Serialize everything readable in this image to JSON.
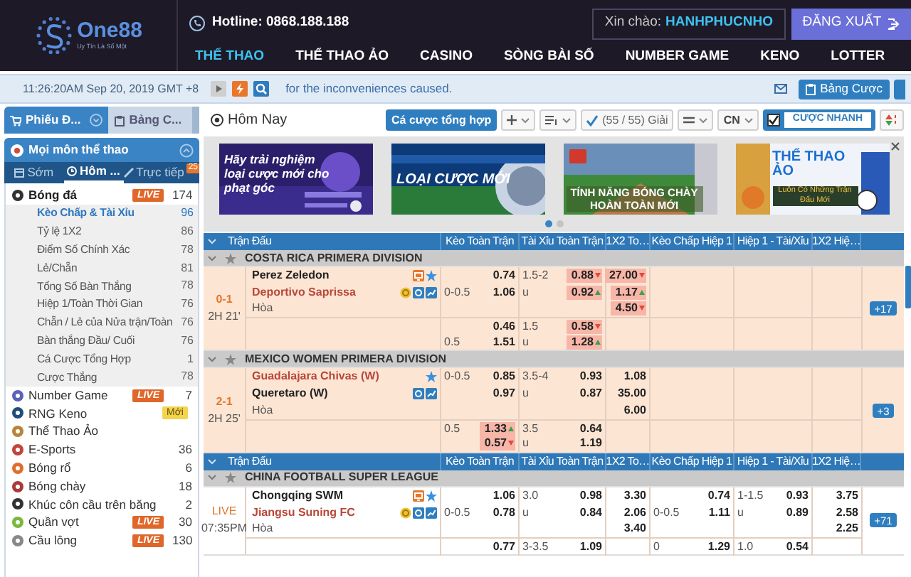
{
  "header": {
    "logo": "One88",
    "tagline": "Uy Tín Là Số Một",
    "hotline": "Hotline: 0868.188.188",
    "greeting": "Xin chào:",
    "username": "HANHPHUCNHO",
    "logout": "ĐĂNG XUẤT",
    "nav": [
      {
        "label": "THỂ THAO",
        "selected": true
      },
      {
        "label": "THỂ THAO ẢO",
        "selected": false
      },
      {
        "label": "CASINO",
        "selected": false
      },
      {
        "label": "SÒNG BÀI SỐ",
        "selected": false
      },
      {
        "label": "NUMBER GAME",
        "selected": false
      },
      {
        "label": "KENO",
        "selected": false
      },
      {
        "label": "LOTTER",
        "selected": false
      }
    ]
  },
  "info_bar": {
    "time": "11:26:20AM Sep 20, 2019 GMT +8",
    "message": "for the inconveniences caused.",
    "button": "Bảng Cược"
  },
  "sidebar": {
    "tabs": [
      {
        "label": "Phiếu Đ...",
        "selected": true
      },
      {
        "label": "Bảng C...",
        "selected": false
      }
    ],
    "panel_title": "Mọi môn thể thao",
    "subtabs": [
      {
        "label": "Sớm",
        "selected": false
      },
      {
        "label": "Hôm ...",
        "selected": true
      },
      {
        "label": "Trực tiếp",
        "selected": false,
        "badge": "25"
      }
    ],
    "sports": [
      {
        "name": "Bóng đá",
        "badge": {
          "text": "LIVE",
          "kind": "live"
        },
        "count": "174",
        "expanded": true,
        "children": [
          {
            "name": "Kèo Chấp & Tài Xỉu",
            "count": "96",
            "selected": true
          },
          {
            "name": "Tỷ lệ 1X2",
            "count": "86",
            "selected": false
          },
          {
            "name": "Điểm Số Chính Xác",
            "count": "78",
            "selected": false
          },
          {
            "name": "Lẻ/Chẵn",
            "count": "81",
            "selected": false
          },
          {
            "name": "Tổng Số Bàn Thắng",
            "count": "78",
            "selected": false
          },
          {
            "name": "Hiệp 1/Toàn Thời Gian",
            "count": "76",
            "selected": false
          },
          {
            "name": "Chẵn / Lẻ của Nửa trận/Toàn",
            "count": "76",
            "selected": false
          },
          {
            "name": "Bàn thắng Đầu/ Cuối",
            "count": "76",
            "selected": false
          },
          {
            "name": "Cá Cược Tổng Hợp",
            "count": "1",
            "selected": false
          },
          {
            "name": "Cược Thắng",
            "count": "78",
            "selected": false
          }
        ]
      },
      {
        "name": "Number Game",
        "badge": {
          "text": "LIVE",
          "kind": "live"
        },
        "count": "7",
        "expanded": false
      },
      {
        "name": "RNG Keno",
        "badge": {
          "text": "Mới",
          "kind": "new"
        },
        "expanded": false
      },
      {
        "name": "Thể Thao Ảo",
        "expanded": false
      },
      {
        "name": "E-Sports",
        "count": "36",
        "expanded": false
      },
      {
        "name": "Bóng rổ",
        "count": "6",
        "expanded": false
      },
      {
        "name": "Bóng chày",
        "count": "18",
        "expanded": false
      },
      {
        "name": "Khúc côn cầu trên băng",
        "count": "2",
        "expanded": false
      },
      {
        "name": "Quần vợt",
        "badge": {
          "text": "LIVE",
          "kind": "live"
        },
        "count": "30",
        "expanded": false
      },
      {
        "name": "Cầu lông",
        "badge": {
          "text": "LIVE",
          "kind": "live"
        },
        "count": "130",
        "expanded": false
      }
    ]
  },
  "toolbar": {
    "title": "Hôm Nay",
    "combo_button": "Cá cược tổng hợp",
    "league_filter": "(55 / 55) Giải",
    "language": "CN",
    "quick_bet": {
      "label": "CƯỢC NHANH",
      "checked": true
    }
  },
  "banners": {
    "slides": [
      {
        "kind": "corner",
        "title": "Hãy trải nghiệm loại cược mới cho phạt góc"
      },
      {
        "kind": "stadium",
        "title": "LOẠI CƯỢC MỚI"
      },
      {
        "kind": "baseball",
        "title": "TÍNH NĂNG BÓNG CHÀY HOÀN TOÀN MỚI"
      },
      {
        "kind": "virtual",
        "title": "THỂ THAO ẢO",
        "subtitle": "Luôn Có Những Trận Đấu Mới"
      }
    ],
    "dots": [
      {
        "selected": true
      },
      {
        "selected": false
      }
    ]
  },
  "table": {
    "rows": [
      {
        "kind": "header",
        "columns": [
          "Trận Đấu",
          "Kèo Toàn Trận",
          "Tài Xỉu Toàn Trận",
          "1X2 To…",
          "Kèo Chấp Hiệp 1",
          "Hiệp 1 - Tài/Xỉu",
          "1X2 Hiệ…"
        ]
      },
      {
        "kind": "league",
        "name": "COSTA RICA PRIMERA DIVISION"
      },
      {
        "kind": "match",
        "in_play": true,
        "status": "0-1",
        "time": "2H 21'",
        "more": "+17",
        "lines": [
          {
            "kind": "team",
            "team": "Perez Zeledon",
            "favorite": false,
            "icons": [
              {
                "kind": "tv"
              },
              {
                "kind": "star"
              }
            ],
            "cells": [
              "",
              "0.74",
              "1.5-2",
              {
                "v": "0.88",
                "kind": "down"
              },
              {
                "v": "27.00",
                "kind": "down"
              },
              "",
              "",
              "",
              "",
              ""
            ]
          },
          {
            "kind": "team",
            "team": "Deportivo Saprissa",
            "favorite": true,
            "icons": [
              {
                "kind": "coin"
              },
              {
                "kind": "money"
              },
              {
                "kind": "stats"
              }
            ],
            "cells": [
              "0-0.5",
              "1.06",
              "u",
              {
                "v": "0.92",
                "kind": "up"
              },
              {
                "v": "1.17",
                "kind": "up"
              },
              "",
              "",
              "",
              "",
              ""
            ]
          },
          {
            "kind": "draw",
            "team": "Hòa",
            "cells": [
              "",
              "",
              "",
              "",
              {
                "v": "4.50",
                "kind": "down"
              },
              "",
              "",
              "",
              "",
              ""
            ]
          },
          {
            "kind": "extra",
            "cells": [
              "",
              "0.46",
              "1.5",
              {
                "v": "0.58",
                "kind": "down"
              },
              "",
              "",
              "",
              "",
              "",
              ""
            ]
          },
          {
            "kind": "extra",
            "cells": [
              "0.5",
              "1.51",
              "u",
              {
                "v": "1.28",
                "kind": "up"
              },
              "",
              "",
              "",
              "",
              "",
              ""
            ]
          }
        ]
      },
      {
        "kind": "league",
        "name": "MEXICO WOMEN PRIMERA DIVISION"
      },
      {
        "kind": "match",
        "in_play": true,
        "status": "2-1",
        "time": "2H 25'",
        "more": "+3",
        "lines": [
          {
            "kind": "team",
            "team": "Guadalajara Chivas (W)",
            "favorite": true,
            "icons": [
              {
                "kind": "star"
              }
            ],
            "cells": [
              "0-0.5",
              "0.85",
              "3.5-4",
              "0.93",
              "1.08",
              "",
              "",
              "",
              "",
              ""
            ]
          },
          {
            "kind": "team",
            "team": "Queretaro (W)",
            "favorite": false,
            "icons": [
              {
                "kind": "money"
              },
              {
                "kind": "stats"
              }
            ],
            "cells": [
              "",
              "0.97",
              "u",
              "0.87",
              "35.00",
              "",
              "",
              "",
              "",
              ""
            ]
          },
          {
            "kind": "draw",
            "team": "Hòa",
            "cells": [
              "",
              "",
              "",
              "",
              "6.00",
              "",
              "",
              "",
              "",
              ""
            ]
          },
          {
            "kind": "extra",
            "cells": [
              "0.5",
              {
                "v": "1.33",
                "kind": "up"
              },
              "3.5",
              "0.64",
              "",
              "",
              "",
              "",
              "",
              ""
            ]
          },
          {
            "kind": "extra",
            "cells": [
              "",
              {
                "v": "0.57",
                "kind": "down"
              },
              "u",
              "1.19",
              "",
              "",
              "",
              "",
              "",
              ""
            ]
          }
        ]
      },
      {
        "kind": "header",
        "columns": [
          "Trận Đấu",
          "Kèo Toàn Trận",
          "Tài Xỉu Toàn Trận",
          "1X2 To…",
          "Kèo Chấp Hiệp 1",
          "Hiệp 1 - Tài/Xỉu",
          "1X2 Hiệ…"
        ]
      },
      {
        "kind": "league",
        "name": "CHINA FOOTBALL SUPER LEAGUE"
      },
      {
        "kind": "match",
        "in_play": false,
        "status": "LIVE",
        "time": "07:35PM",
        "more": "+71",
        "lines": [
          {
            "kind": "team",
            "team": "Chongqing SWM",
            "favorite": false,
            "icons": [
              {
                "kind": "tv"
              },
              {
                "kind": "star"
              }
            ],
            "cells": [
              "",
              "1.06",
              "3.0",
              "0.98",
              "3.30",
              "",
              "0.74",
              "1-1.5",
              "0.93",
              "3.75"
            ]
          },
          {
            "kind": "team",
            "team": "Jiangsu Suning FC",
            "favorite": true,
            "icons": [
              {
                "kind": "coin"
              },
              {
                "kind": "money"
              },
              {
                "kind": "stats"
              }
            ],
            "cells": [
              "0-0.5",
              "0.78",
              "u",
              "0.84",
              "2.06",
              "0-0.5",
              "1.11",
              "u",
              "0.89",
              "2.58"
            ]
          },
          {
            "kind": "draw",
            "team": "Hòa",
            "cells": [
              "",
              "",
              "",
              "",
              "3.40",
              "",
              "",
              "",
              "",
              "2.25"
            ]
          },
          {
            "kind": "extra",
            "cells": [
              "",
              "0.77",
              "3-3.5",
              "1.09",
              "",
              "0",
              "1.29",
              "1.0",
              "0.54",
              ""
            ]
          }
        ]
      }
    ]
  }
}
